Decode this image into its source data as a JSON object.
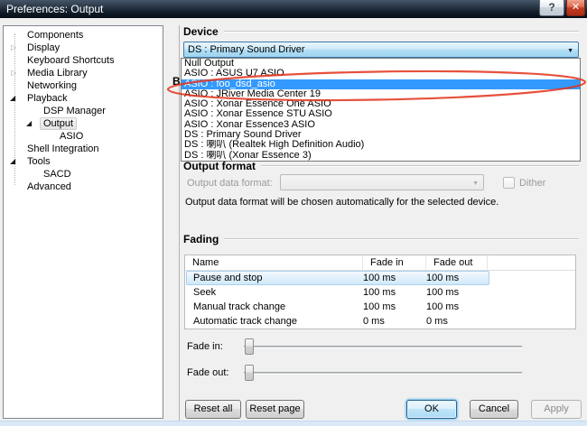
{
  "window": {
    "title": "Preferences: Output",
    "help_glyph": "?",
    "close_glyph": "✕"
  },
  "colors": {
    "selection_blue": "#3399ff",
    "focus_button_blue": "#aadcf5",
    "annotation_red": "#e2321b",
    "close_button_red": "#c33d24",
    "titlebar_navy": "#243140"
  },
  "tree": {
    "items": [
      {
        "label": "Components",
        "depth": 0,
        "expander": "none"
      },
      {
        "label": "Display",
        "depth": 0,
        "expander": "collapsed"
      },
      {
        "label": "Keyboard Shortcuts",
        "depth": 0,
        "expander": "none"
      },
      {
        "label": "Media Library",
        "depth": 0,
        "expander": "collapsed"
      },
      {
        "label": "Networking",
        "depth": 0,
        "expander": "none"
      },
      {
        "label": "Playback",
        "depth": 0,
        "expander": "expanded"
      },
      {
        "label": "DSP Manager",
        "depth": 1,
        "expander": "none"
      },
      {
        "label": "Output",
        "depth": 1,
        "expander": "expanded",
        "selected": true
      },
      {
        "label": "ASIO",
        "depth": 2,
        "expander": "none"
      },
      {
        "label": "Shell Integration",
        "depth": 0,
        "expander": "none"
      },
      {
        "label": "Tools",
        "depth": 0,
        "expander": "expanded"
      },
      {
        "label": "SACD",
        "depth": 1,
        "expander": "none"
      },
      {
        "label": "Advanced",
        "depth": 0,
        "expander": "none"
      }
    ]
  },
  "device": {
    "header": "Device",
    "combobox_value": "DS : Primary Sound Driver",
    "dropdown_items": [
      "Null Output",
      "ASIO : ASUS U7 ASIO",
      "ASIO : foo_dsd_asio",
      "ASIO : JRiver Media Center 19",
      "ASIO : Xonar Essence One ASIO",
      "ASIO : Xonar Essence STU ASIO",
      "ASIO : Xonar Essence3 ASIO",
      "DS : Primary Sound Driver",
      "DS : 喇叭 (Realtek High Definition Audio)",
      "DS : 喇叭 (Xonar Essence 3)"
    ],
    "highlighted_item": "ASIO : foo_dsd_asio",
    "hidden_section_partial_letter": "B"
  },
  "output_format": {
    "header": "Output format",
    "label": "Output data format:",
    "combobox_value": "",
    "dither_label": "Dither",
    "note": "Output data format will be chosen automatically for the selected device."
  },
  "fading": {
    "header": "Fading",
    "columns": [
      "Name",
      "Fade in",
      "Fade out"
    ],
    "rows": [
      {
        "name": "Pause and stop",
        "fade_in": "100 ms",
        "fade_out": "100 ms",
        "selected": true
      },
      {
        "name": "Seek",
        "fade_in": "100 ms",
        "fade_out": "100 ms",
        "selected": false
      },
      {
        "name": "Manual track change",
        "fade_in": "100 ms",
        "fade_out": "100 ms",
        "selected": false
      },
      {
        "name": "Automatic track change",
        "fade_in": "0 ms",
        "fade_out": "0 ms",
        "selected": false
      }
    ],
    "fade_in_label": "Fade in:",
    "fade_out_label": "Fade out:"
  },
  "buttons": {
    "reset_all": "Reset all",
    "reset_page": "Reset page",
    "ok": "OK",
    "cancel": "Cancel",
    "apply": "Apply"
  }
}
